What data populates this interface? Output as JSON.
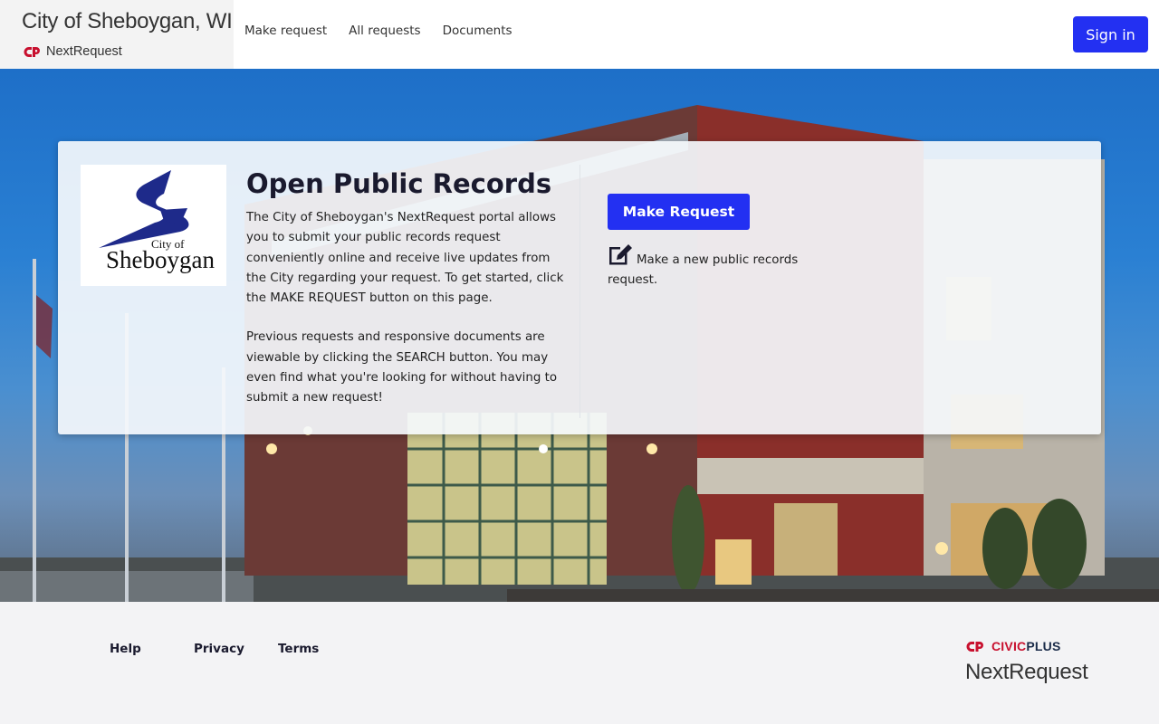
{
  "header": {
    "city_name": "City of Sheboygan, WI",
    "product_name": "NextRequest",
    "nav": [
      {
        "label": "Make request"
      },
      {
        "label": "All requests"
      },
      {
        "label": "Documents"
      }
    ],
    "sign_in_label": "Sign in"
  },
  "card": {
    "logo_text_top": "City of",
    "logo_text_main": "Sheboygan",
    "title": "Open Public Records",
    "paragraph1": "The City of Sheboygan's NextRequest portal allows you to submit your public records request conveniently online and receive live updates from the City regarding your request. To get started, click the MAKE REQUEST button on this page.",
    "paragraph2": "Previous requests and responsive documents are viewable by clicking the SEARCH button. You may even find what you're looking for without having to submit a new request!",
    "make_request_label": "Make Request",
    "make_request_desc": "Make a new public records request."
  },
  "footer": {
    "links": [
      {
        "label": "Help"
      },
      {
        "label": "Privacy"
      },
      {
        "label": "Terms"
      }
    ],
    "civic_red": "CIVIC",
    "civic_dark": "PLUS",
    "product_name": "NextRequest"
  },
  "colors": {
    "primary_button": "#2330f2",
    "brand_red": "#c8102e",
    "civic_navy": "#1a2b49"
  }
}
